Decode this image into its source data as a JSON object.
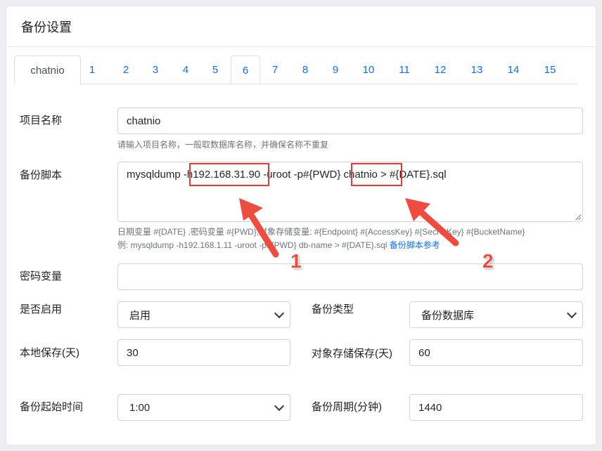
{
  "header": {
    "title": "备份设置"
  },
  "tabs": [
    "chatnio",
    "1",
    "2",
    "3",
    "4",
    "5",
    "6",
    "7",
    "8",
    "9",
    "10",
    "11",
    "12",
    "13",
    "14",
    "15"
  ],
  "form": {
    "project_name": {
      "label": "项目名称",
      "value": "chatnio",
      "help": "请输入项目名称，一般取数据库名称，并确保名称不重复"
    },
    "backup_script": {
      "label": "备份脚本",
      "value": "mysqldump -h192.168.31.90 -uroot -p#{PWD} chatnio > #{DATE}.sql",
      "help_line1": "日期变量 #{DATE} ,密码变量 #{PWD},对象存储变量: #{Endpoint} #{AccessKey} #{SecretKey} #{BucketName}",
      "help_line2": "例: mysqldump -h192.168.1.11 -uroot -p#{PWD} db-name > #{DATE}.sql",
      "help_link": "备份脚本参考"
    },
    "password_var": {
      "label": "密码变量",
      "value": ""
    },
    "enabled": {
      "label": "是否启用",
      "value": "启用"
    },
    "backup_type": {
      "label": "备份类型",
      "value": "备份数据库"
    },
    "local_keep": {
      "label": "本地保存(天)",
      "value": "30"
    },
    "object_keep": {
      "label": "对象存储保存(天)",
      "value": "60"
    },
    "start_time": {
      "label": "备份起始时间",
      "value": "1:00"
    },
    "period": {
      "label": "备份周期(分钟)",
      "value": "1440"
    }
  },
  "annotations": {
    "arrow1": "1",
    "arrow2": "2",
    "color": "#e53935"
  }
}
